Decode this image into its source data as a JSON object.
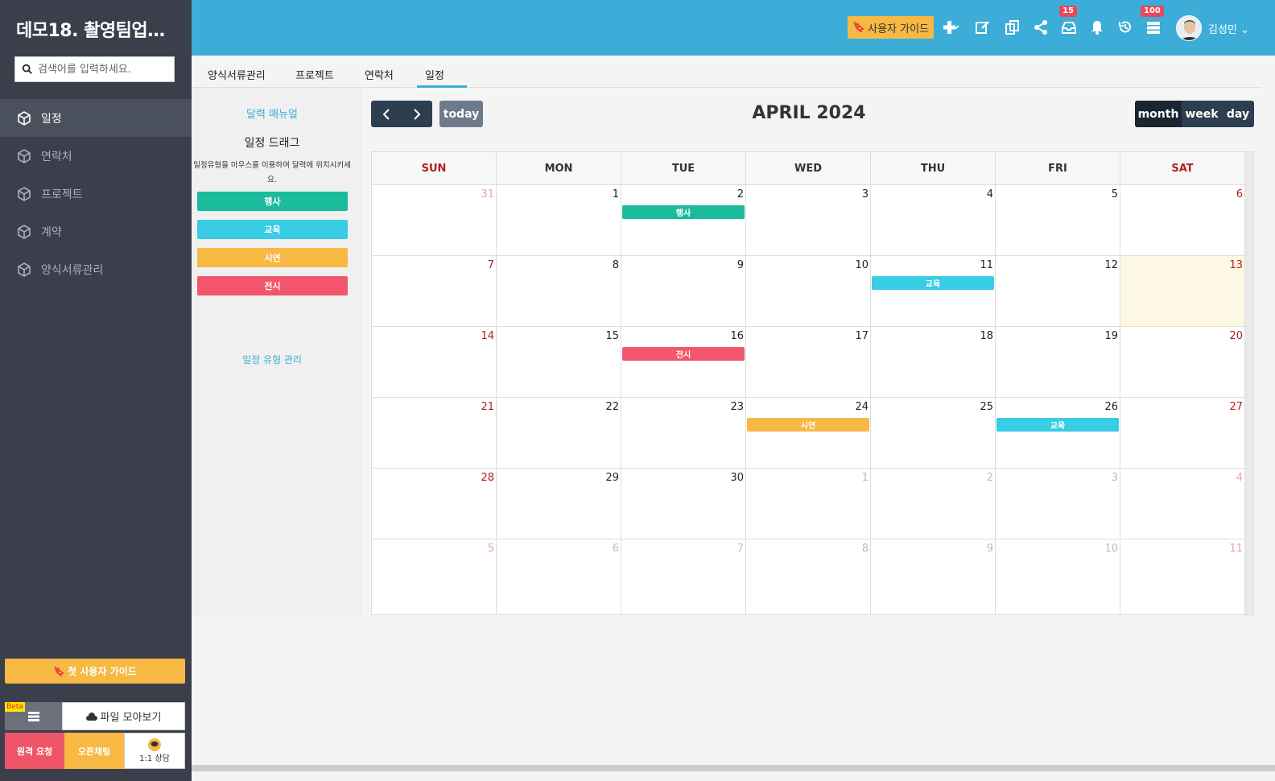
{
  "sidebar": {
    "brand": "데모18. 촬영팀업…",
    "search_placeholder": "검색어를 입력하세요.",
    "items": [
      {
        "label": "일정",
        "active": true
      },
      {
        "label": "연락처"
      },
      {
        "label": "프로젝트"
      },
      {
        "label": "계약"
      },
      {
        "label": "양식서류관리"
      }
    ],
    "first_guide": "첫 사용자 가이드",
    "beta": "Beta",
    "file_collect": "파일 모아보기",
    "remote_request": "원격 요청",
    "open_chat": "오픈채팅",
    "consult": "1:1 상담"
  },
  "header": {
    "user_guide": "사용자 가이드",
    "inbox_badge": "15",
    "list_badge": "100",
    "user_name": "김성민",
    "colors": {
      "bar": "#3cadd9",
      "accent": "#f7b844",
      "badge": "#e9485a"
    }
  },
  "tabs": [
    "양식서류관리",
    "프로젝트",
    "연락처",
    "일정"
  ],
  "left_panel": {
    "manual": "달력 매뉴얼",
    "drag_title": "일정 드래그",
    "drag_desc_1": "일정유형을 마우스를 이용하여 달력에 위치시키세",
    "drag_desc_2": "요.",
    "types": [
      {
        "label": "행사",
        "color": "#1abc9c"
      },
      {
        "label": "교육",
        "color": "#39cce5"
      },
      {
        "label": "시연",
        "color": "#f7b844"
      },
      {
        "label": "전시",
        "color": "#f1566c"
      }
    ],
    "manage": "일정 유형 관리"
  },
  "calendar": {
    "title": "APRIL 2024",
    "today_label": "today",
    "views": [
      "month",
      "week",
      "day"
    ],
    "active_view": "month",
    "days_of_week": [
      "SUN",
      "MON",
      "TUE",
      "WED",
      "THU",
      "FRI",
      "SAT"
    ],
    "weeks": [
      [
        {
          "d": "31",
          "o": true
        },
        {
          "d": "1"
        },
        {
          "d": "2"
        },
        {
          "d": "3"
        },
        {
          "d": "4"
        },
        {
          "d": "5"
        },
        {
          "d": "6"
        }
      ],
      [
        {
          "d": "7"
        },
        {
          "d": "8"
        },
        {
          "d": "9"
        },
        {
          "d": "10"
        },
        {
          "d": "11"
        },
        {
          "d": "12"
        },
        {
          "d": "13",
          "t": true
        }
      ],
      [
        {
          "d": "14"
        },
        {
          "d": "15"
        },
        {
          "d": "16"
        },
        {
          "d": "17"
        },
        {
          "d": "18"
        },
        {
          "d": "19"
        },
        {
          "d": "20"
        }
      ],
      [
        {
          "d": "21"
        },
        {
          "d": "22"
        },
        {
          "d": "23"
        },
        {
          "d": "24"
        },
        {
          "d": "25"
        },
        {
          "d": "26"
        },
        {
          "d": "27"
        }
      ],
      [
        {
          "d": "28"
        },
        {
          "d": "29"
        },
        {
          "d": "30"
        },
        {
          "d": "1",
          "o": true
        },
        {
          "d": "2",
          "o": true
        },
        {
          "d": "3",
          "o": true
        },
        {
          "d": "4",
          "o": true
        }
      ],
      [
        {
          "d": "5",
          "o": true
        },
        {
          "d": "6",
          "o": true
        },
        {
          "d": "7",
          "o": true
        },
        {
          "d": "8",
          "o": true
        },
        {
          "d": "9",
          "o": true
        },
        {
          "d": "10",
          "o": true
        },
        {
          "d": "11",
          "o": true
        }
      ]
    ],
    "events": [
      {
        "week": 0,
        "day": 2,
        "label": "행사",
        "color": "#1abc9c"
      },
      {
        "week": 1,
        "day": 4,
        "label": "교육",
        "color": "#39cce5"
      },
      {
        "week": 2,
        "day": 2,
        "label": "전시",
        "color": "#f1566c"
      },
      {
        "week": 3,
        "day": 3,
        "label": "시연",
        "color": "#f7b844"
      },
      {
        "week": 3,
        "day": 5,
        "label": "교육",
        "color": "#39cce5"
      }
    ]
  }
}
